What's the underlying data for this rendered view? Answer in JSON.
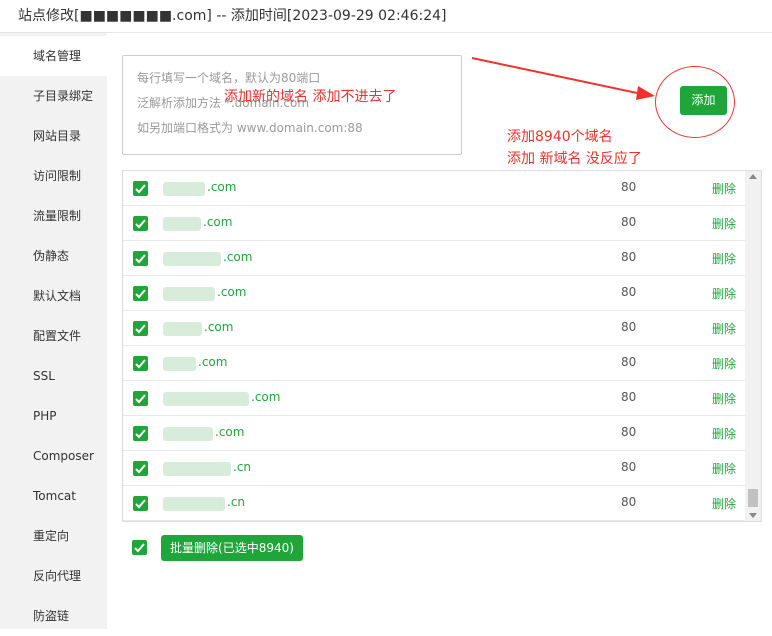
{
  "title": "站点修改[■■■■■■■.com] -- 添加时间[2023-09-29 02:46:24]",
  "sidebar": {
    "items": [
      {
        "label": "域名管理",
        "active": true
      },
      {
        "label": "子目录绑定"
      },
      {
        "label": "网站目录"
      },
      {
        "label": "访问限制"
      },
      {
        "label": "流量限制"
      },
      {
        "label": "伪静态"
      },
      {
        "label": "默认文档"
      },
      {
        "label": "配置文件"
      },
      {
        "label": "SSL"
      },
      {
        "label": "PHP"
      },
      {
        "label": "Composer"
      },
      {
        "label": "Tomcat"
      },
      {
        "label": "重定向"
      },
      {
        "label": "反向代理"
      },
      {
        "label": "防盗链"
      }
    ]
  },
  "domain_input": {
    "placeholder_lines": [
      "每行填写一个域名，默认为80端口",
      "泛解析添加方法 *.domain.com",
      "如另加端口格式为 www.domain.com:88"
    ]
  },
  "annotations": {
    "input_note": "添加新的域名 添加不进去了",
    "side_note_1": "添加8940个域名",
    "side_note_2": "添加 新域名 没反应了"
  },
  "add_button": "添加",
  "domains": [
    {
      "name": ".com",
      "port": "80",
      "action": "删除"
    },
    {
      "name": ".com",
      "port": "80",
      "action": "删除"
    },
    {
      "name": ".com",
      "port": "80",
      "action": "删除"
    },
    {
      "name": ".com",
      "port": "80",
      "action": "删除"
    },
    {
      "name": ".com",
      "port": "80",
      "action": "删除"
    },
    {
      "name": ".com",
      "port": "80",
      "action": "删除"
    },
    {
      "name": ".com",
      "port": "80",
      "action": "删除"
    },
    {
      "name": ".com",
      "port": "80",
      "action": "删除"
    },
    {
      "name": ".cn",
      "port": "80",
      "action": "删除"
    },
    {
      "name": ".cn",
      "port": "80",
      "action": "删除"
    }
  ],
  "batch_delete": "批量删除(已选中8940)",
  "colors": {
    "accent": "#20a53a",
    "annotation": "#f0302a"
  }
}
